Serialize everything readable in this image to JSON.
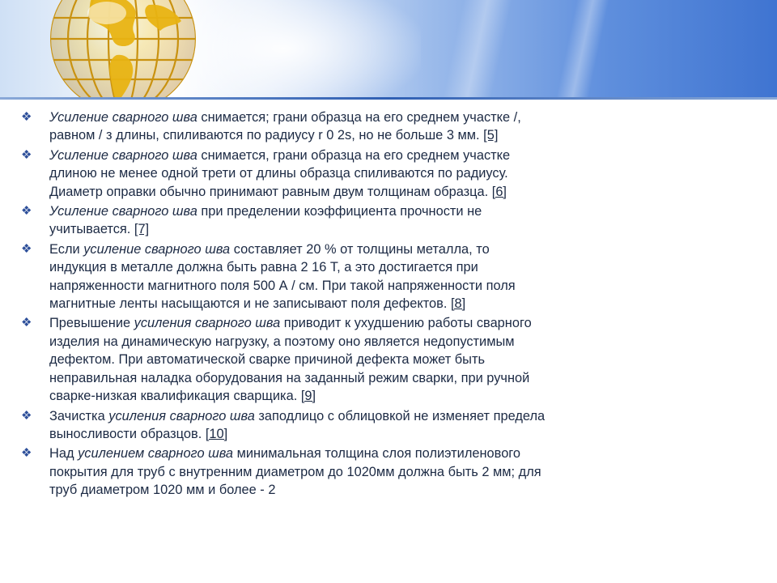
{
  "slide": {
    "items": [
      {
        "parts": [
          {
            "text": "Усиление сварного шва",
            "style": "italic"
          },
          {
            "text": " снимается; грани образца на его среднем участке /, равном / з длины, спиливаются по радиусу r 0 2s, но не больше 3 мм. ",
            "style": "normal"
          },
          {
            "text": "[5]",
            "style": "link"
          }
        ]
      },
      {
        "parts": [
          {
            "text": "Усиление сварного шва",
            "style": "italic"
          },
          {
            "text": " снимается, грани образца на его среднем участке длиною не менее одной трети от длины образца спиливаются по радиусу. Диаметр оправки обычно принимают равным двум толщинам образца. ",
            "style": "normal"
          },
          {
            "text": "[6]",
            "style": "link"
          }
        ]
      },
      {
        "parts": [
          {
            "text": "Усиление сварного шва",
            "style": "italic"
          },
          {
            "text": " при пределении коэффициента прочности не учитывается. ",
            "style": "normal"
          },
          {
            "text": "[7]",
            "style": "link"
          }
        ]
      },
      {
        "parts": [
          {
            "text": "Если ",
            "style": "normal"
          },
          {
            "text": "усиление сварного шва",
            "style": "italic"
          },
          {
            "text": " составляет 20 % от толщины металла, то индукция в металле должна быть равна 2 16 Т, а это достигается при напряженности магнитного поля 500 А / см. При такой напряженности поля магнитные ленты насыщаются и не записывают поля дефектов. ",
            "style": "normal"
          },
          {
            "text": "[8]",
            "style": "link"
          }
        ]
      },
      {
        "parts": [
          {
            "text": "Превышение ",
            "style": "normal"
          },
          {
            "text": "усиления сварного шва",
            "style": "italic"
          },
          {
            "text": " приводит к ухудшению работы сварного изделия на динамическую нагрузку, а поэтому оно является недопустимым дефектом. При автоматической сварке причиной дефекта может быть неправильная наладка оборудования на заданный режим сварки, при ручной сварке-низкая квалификация сварщика. ",
            "style": "normal"
          },
          {
            "text": "[9]",
            "style": "link"
          }
        ]
      },
      {
        "parts": [
          {
            "text": "Зачистка ",
            "style": "normal"
          },
          {
            "text": "усиления сварного шва",
            "style": "italic"
          },
          {
            "text": " заподлицо с облицовкой не изменяет предела выносливости образцов. ",
            "style": "normal"
          },
          {
            "text": "[10]",
            "style": "link"
          }
        ]
      },
      {
        "parts": [
          {
            "text": "Над ",
            "style": "normal"
          },
          {
            "text": "усилением сварного шва",
            "style": "italic"
          },
          {
            "text": " минимальная толщина слоя полиэтиленового покрытия для труб с внутренним диаметром до 1020мм должна быть 2 мм; для труб диаметром 1020 мм и более - 2",
            "style": "normal"
          }
        ]
      }
    ]
  },
  "colors": {
    "text": "#1c2a44",
    "bullet": "#2d4f9a",
    "header_blue": "#3f74d1",
    "globe_gold": "#e8b414"
  },
  "icons": {
    "bullet": "diamond-cluster-bullet-icon",
    "header": "golden-globe-icon"
  }
}
